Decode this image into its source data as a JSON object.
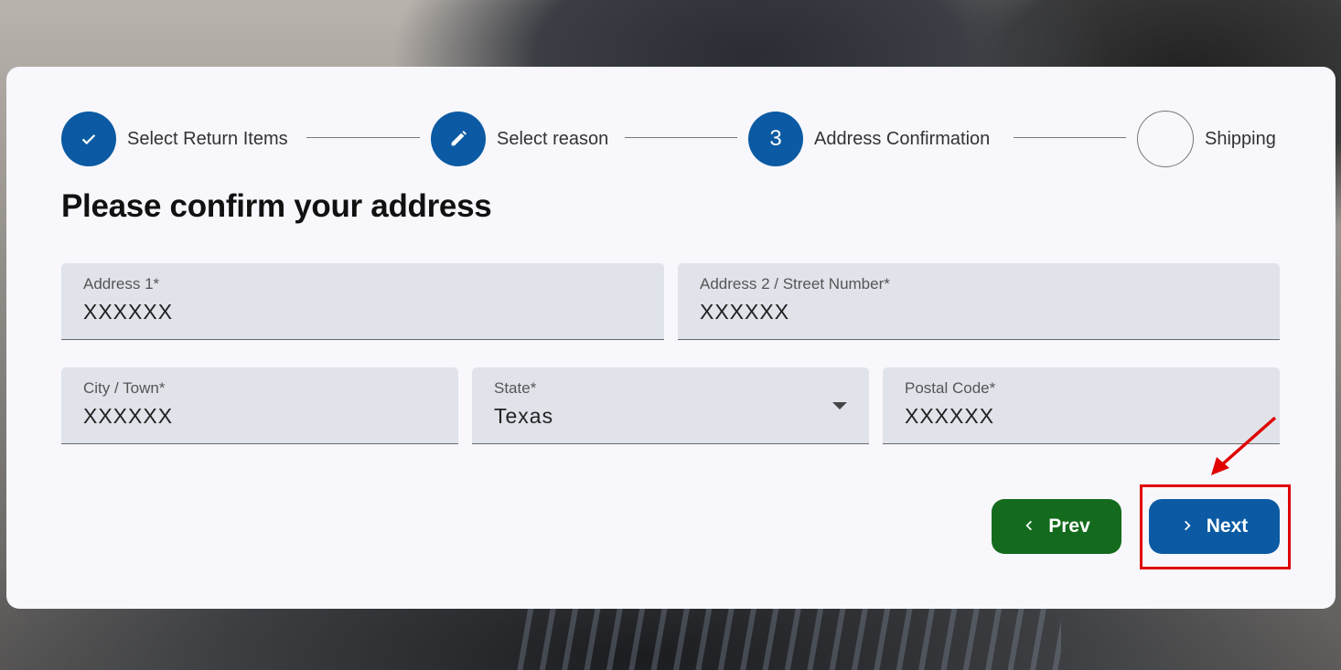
{
  "stepper": {
    "steps": [
      {
        "label": "Select Return Items",
        "icon": "check-icon",
        "marker": ""
      },
      {
        "label": "Select reason",
        "icon": "pencil-icon",
        "marker": ""
      },
      {
        "label": "Address Confirmation",
        "icon": "",
        "marker": "3"
      },
      {
        "label": "Shipping",
        "icon": "",
        "marker": ""
      }
    ]
  },
  "page": {
    "title": "Please confirm your address"
  },
  "form": {
    "address1": {
      "label": "Address 1*",
      "value": "XXXXXX"
    },
    "address2": {
      "label": "Address 2 / Street Number*",
      "value": "XXXXXX"
    },
    "city": {
      "label": "City / Town*",
      "value": "XXXXXX"
    },
    "state": {
      "label": "State*",
      "value": "Texas"
    },
    "postal": {
      "label": "Postal Code*",
      "value": "XXXXXX"
    }
  },
  "actions": {
    "prev_label": "Prev",
    "next_label": "Next"
  },
  "colors": {
    "primary": "#0b5aa3",
    "prev_button": "#146b1d",
    "highlight": "#e00000"
  }
}
